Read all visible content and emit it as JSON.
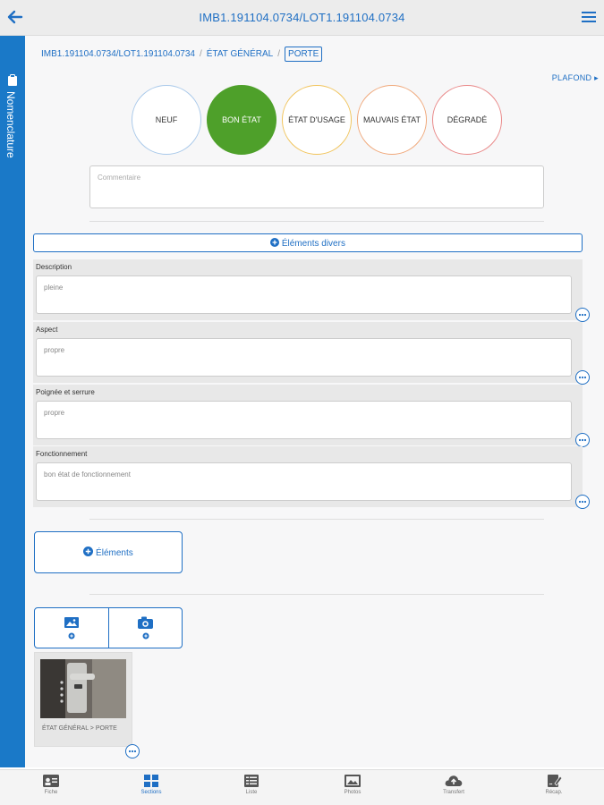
{
  "header": {
    "title": "IMB1.191104.0734/LOT1.191104.0734"
  },
  "sidetab": {
    "label": "Nomenclature"
  },
  "breadcrumb": {
    "part1": "IMB1.191104.0734/LOT1.191104.0734",
    "sep1": "/",
    "part2": "ÉTAT GÉNÉRAL",
    "sep2": "/",
    "current": "PORTE"
  },
  "plafond_link": "PLAFOND",
  "states": [
    {
      "label": "NEUF"
    },
    {
      "label": "BON ÉTAT"
    },
    {
      "label": "ÉTAT D'USAGE"
    },
    {
      "label": "MAUVAIS ÉTAT"
    },
    {
      "label": "DÉGRADÉ"
    }
  ],
  "comment": {
    "placeholder": "Commentaire"
  },
  "divers_button": "Éléments divers",
  "sections": [
    {
      "label": "Description",
      "value": "pleine"
    },
    {
      "label": "Aspect",
      "value": "propre"
    },
    {
      "label": "Poignée et serrure",
      "value": "propre"
    },
    {
      "label": "Fonctionnement",
      "value": "bon état de fonctionnement"
    }
  ],
  "elements_button": "Éléments",
  "photo": {
    "caption": "ÉTAT GÉNÉRAL > PORTE"
  },
  "bottom_nav": [
    {
      "label": "Fiche",
      "icon": "id-card-icon"
    },
    {
      "label": "Sections",
      "icon": "grid-icon"
    },
    {
      "label": "Liste",
      "icon": "list-icon"
    },
    {
      "label": "Photos",
      "icon": "image-icon"
    },
    {
      "label": "Transfert",
      "icon": "cloud-upload-icon"
    },
    {
      "label": "Récap.",
      "icon": "signature-icon"
    }
  ],
  "colors": {
    "accent": "#1f6fc4",
    "selected_state": "#4ea02a",
    "sidetab": "#1a79c8"
  }
}
